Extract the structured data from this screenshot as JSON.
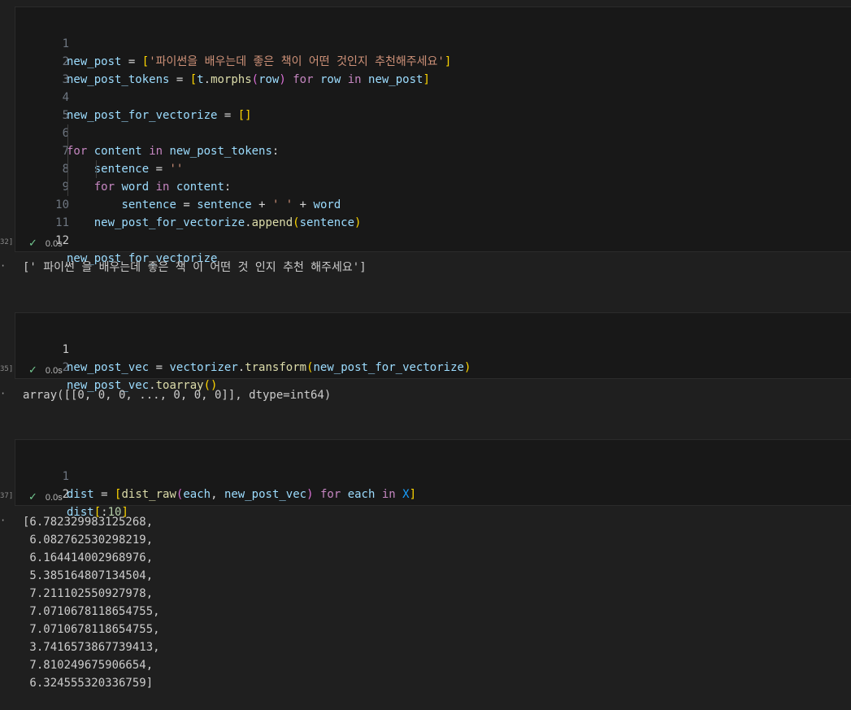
{
  "cells": [
    {
      "exec_label": "32]",
      "status": "0.0s",
      "lines": [
        {
          "n": "1",
          "t": "new_post = ['파이썬을 배우는데 좋은 책이 어떤 것인지 추천해주세요']"
        },
        {
          "n": "2",
          "t": "new_post_tokens = [t.morphs(row) for row in new_post]"
        },
        {
          "n": "3",
          "t": ""
        },
        {
          "n": "4",
          "t": "new_post_for_vectorize = []"
        },
        {
          "n": "5",
          "t": ""
        },
        {
          "n": "6",
          "t": "for content in new_post_tokens:"
        },
        {
          "n": "7",
          "t": "    sentence = ''"
        },
        {
          "n": "8",
          "t": "    for word in content:"
        },
        {
          "n": "9",
          "t": "        sentence = sentence + ' ' + word"
        },
        {
          "n": "10",
          "t": "    new_post_for_vectorize.append(sentence)"
        },
        {
          "n": "11",
          "t": ""
        },
        {
          "n": "12",
          "t": "new_post_for_vectorize"
        }
      ],
      "output": [
        "[' 파이썬 을 배우는데 좋은 책 이 어떤 것 인지 추천 해주세요']"
      ]
    },
    {
      "exec_label": "35]",
      "status": "0.0s",
      "lines": [
        {
          "n": "1",
          "t": "new_post_vec = vectorizer.transform(new_post_for_vectorize)"
        },
        {
          "n": "2",
          "t": "new_post_vec.toarray()"
        }
      ],
      "output": [
        "array([[0, 0, 0, ..., 0, 0, 0]], dtype=int64)"
      ]
    },
    {
      "exec_label": "37]",
      "status": "0.0s",
      "lines": [
        {
          "n": "1",
          "t": "dist = [dist_raw(each, new_post_vec) for each in X]"
        },
        {
          "n": "2",
          "t": "dist[:10]"
        }
      ],
      "output": [
        "[6.782329983125268,",
        " 6.082762530298219,",
        " 6.164414002968976,",
        " 5.385164807134504,",
        " 7.211102550927978,",
        " 7.0710678118654755,",
        " 7.0710678118654755,",
        " 3.7416573867739413,",
        " 7.810249675906654,",
        " 6.324555320336759]"
      ]
    }
  ],
  "icons": {
    "status_check": "check-icon",
    "output_bullet": "ellipsis-icon"
  },
  "colors": {
    "background": "#1f1f1f",
    "cell_bg": "#181818",
    "success": "#73c991"
  }
}
